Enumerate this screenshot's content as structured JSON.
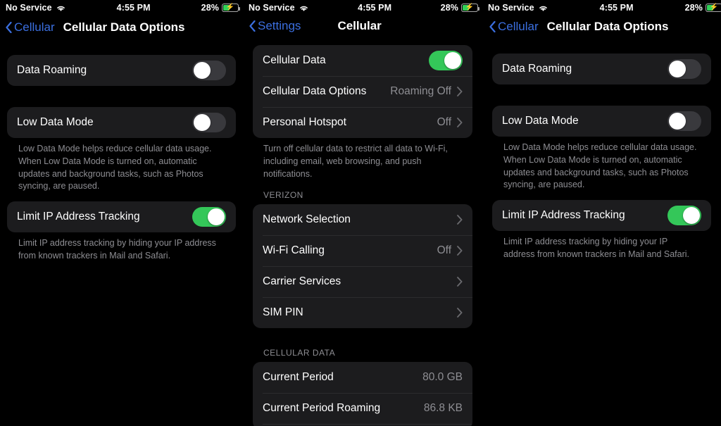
{
  "status_bar": {
    "carrier": "No Service",
    "wifi_icon": "wifi-icon",
    "time": "4:55 PM",
    "battery_percent": "28%",
    "battery_icon": "battery-charging-icon"
  },
  "colors": {
    "accent_blue": "#3b6fe0",
    "toggle_on_green": "#34c759",
    "toggle_off_gray": "#39393d",
    "card_background": "#1c1c1e",
    "secondary_text": "#8e8e93",
    "page_background": "#000000"
  },
  "panels": {
    "left": {
      "nav": {
        "back_label": "Cellular",
        "title": "Cellular Data Options"
      },
      "rows": {
        "data_roaming": {
          "label": "Data Roaming",
          "toggle": "off"
        },
        "low_data_mode": {
          "label": "Low Data Mode",
          "toggle": "off"
        },
        "limit_ip": {
          "label": "Limit IP Address Tracking",
          "toggle": "on"
        }
      },
      "footnotes": {
        "low_data_mode": "Low Data Mode helps reduce cellular data usage. When Low Data Mode is turned on, automatic updates and background tasks, such as Photos syncing, are paused.",
        "limit_ip": "Limit IP address tracking by hiding your IP address from known trackers in Mail and Safari."
      }
    },
    "middle": {
      "nav": {
        "back_label": "Settings",
        "title": "Cellular"
      },
      "group1": [
        {
          "label": "Cellular Data",
          "control": "toggle",
          "toggle": "on"
        },
        {
          "label": "Cellular Data Options",
          "control": "disclosure",
          "value": "Roaming Off"
        },
        {
          "label": "Personal Hotspot",
          "control": "disclosure",
          "value": "Off"
        }
      ],
      "group1_footnote": "Turn off cellular data to restrict all data to Wi-Fi, including email, web browsing, and push notifications.",
      "carrier_section": {
        "header": "VERIZON",
        "rows": [
          {
            "label": "Network Selection",
            "control": "disclosure",
            "value": ""
          },
          {
            "label": "Wi-Fi Calling",
            "control": "disclosure",
            "value": "Off"
          },
          {
            "label": "Carrier Services",
            "control": "disclosure",
            "value": ""
          },
          {
            "label": "SIM PIN",
            "control": "disclosure",
            "value": ""
          }
        ]
      },
      "cellular_data_section": {
        "header": "CELLULAR DATA",
        "rows": [
          {
            "label": "Current Period",
            "value": "80.0 GB"
          },
          {
            "label": "Current Period Roaming",
            "value": "86.8 KB"
          }
        ]
      }
    },
    "right": {
      "nav": {
        "back_label": "Cellular",
        "title": "Cellular Data Options"
      },
      "rows": {
        "data_roaming": {
          "label": "Data Roaming",
          "toggle": "off"
        },
        "low_data_mode": {
          "label": "Low Data Mode",
          "toggle": "off"
        },
        "limit_ip": {
          "label": "Limit IP Address Tracking",
          "toggle": "on"
        }
      },
      "footnotes": {
        "low_data_mode": "Low Data Mode helps reduce cellular data usage. When Low Data Mode is turned on, automatic updates and background tasks, such as Photos syncing, are paused.",
        "limit_ip": "Limit IP address tracking by hiding your IP address from known trackers in Mail and Safari."
      }
    }
  }
}
